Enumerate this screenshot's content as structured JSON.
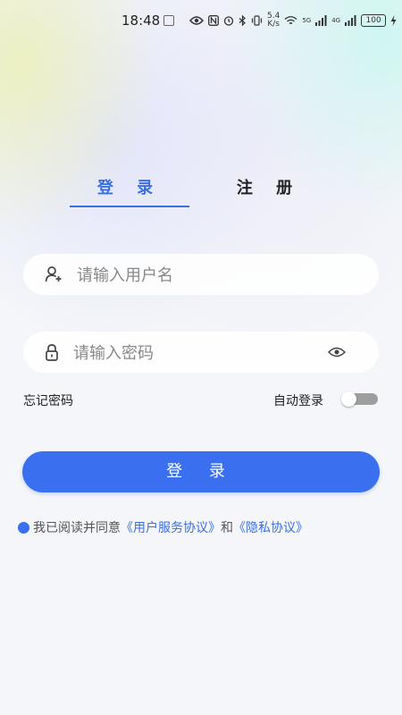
{
  "status_bar": {
    "time": "18:48",
    "network_speed_value": "5.4",
    "network_speed_unit": "K/s",
    "signal1_label": "5G",
    "signal2_label": "4G",
    "battery": "100"
  },
  "tabs": {
    "login_label": "登 录",
    "register_label": "注 册",
    "active": "login"
  },
  "form": {
    "username_placeholder": "请输入用户名",
    "password_placeholder": "请输入密码",
    "forgot_password": "忘记密码",
    "auto_login_label": "自动登录",
    "auto_login_enabled": false
  },
  "login_button_label": "登 录",
  "agreement": {
    "prefix": "我已阅读并同意",
    "user_agreement": "《用户服务协议》",
    "and": "和",
    "privacy_policy": "《隐私协议》"
  },
  "colors": {
    "accent": "#3a6ff0",
    "tab_active": "#3b6fe0",
    "toggle_off": "#9e9e9e"
  }
}
